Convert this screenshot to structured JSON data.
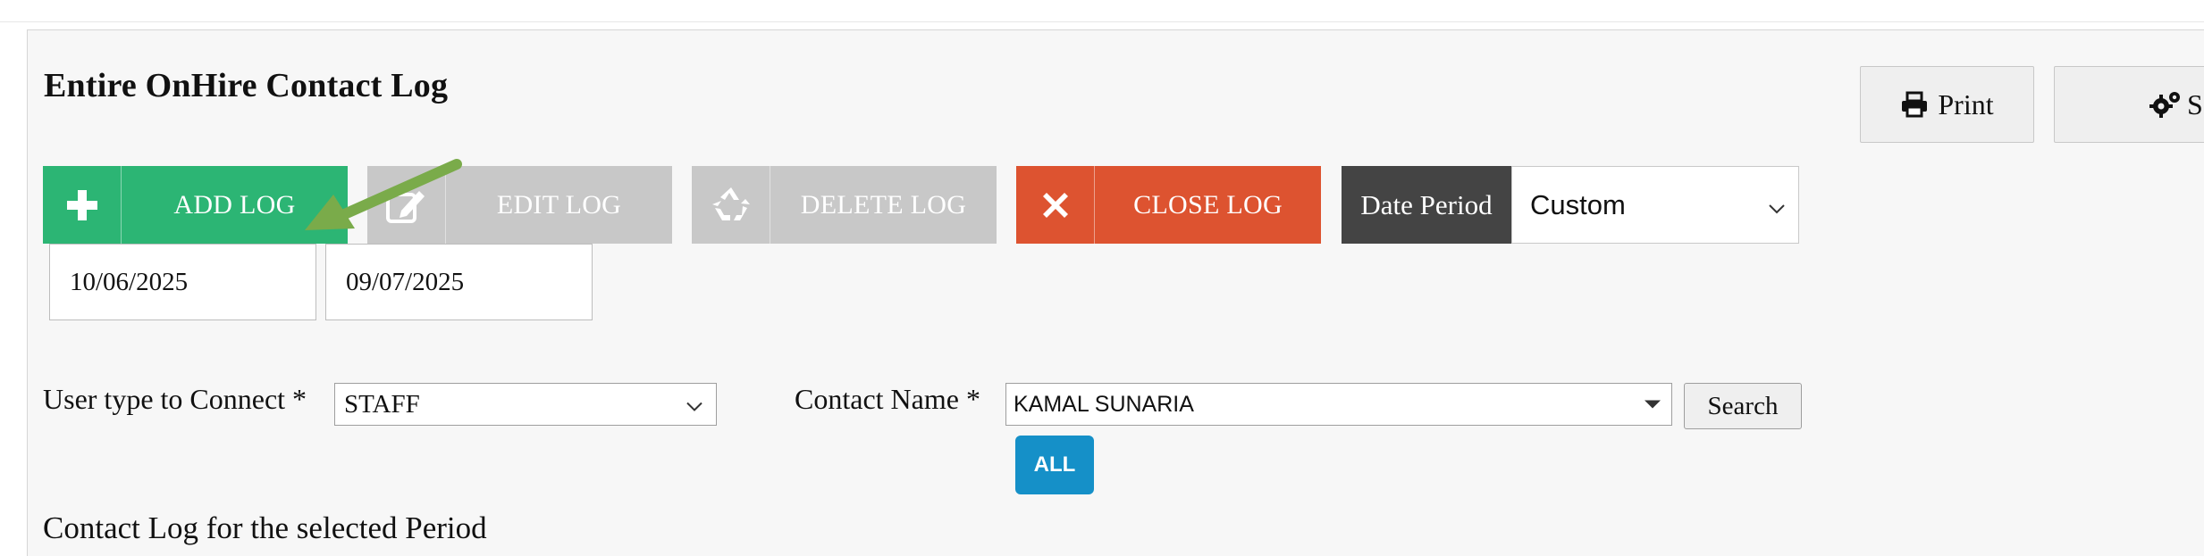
{
  "page": {
    "title": "Entire OnHire Contact Log",
    "section_title": "Contact Log for the selected Period"
  },
  "top_buttons": {
    "print_label": "Print",
    "settings_label": "S"
  },
  "actions": {
    "add_label": "ADD LOG",
    "edit_label": "EDIT LOG",
    "delete_label": "DELETE LOG",
    "close_label": "CLOSE LOG"
  },
  "date_period": {
    "label": "Date Period",
    "selected": "Custom",
    "from": "10/06/2025",
    "to": "09/07/2025"
  },
  "filters": {
    "user_type_label": "User type to Connect *",
    "user_type_value": "STAFF",
    "contact_name_label": "Contact Name *",
    "contact_name_value": "KAMAL SUNARIA",
    "search_label": "Search",
    "all_label": "ALL"
  },
  "colors": {
    "add": "#2cb574",
    "disabled": "#c8c8c8",
    "close": "#dd5330",
    "date_label_bg": "#444444",
    "all_button": "#1590c8",
    "annotation_arrow": "#7aab4a"
  }
}
